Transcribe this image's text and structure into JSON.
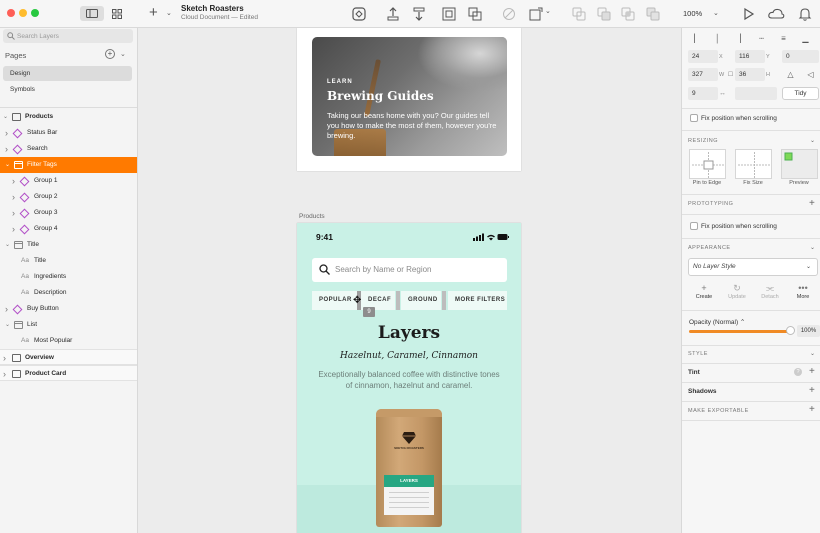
{
  "toolbar": {
    "doc_title": "Sketch Roasters",
    "doc_subtitle": "Cloud Document — Edited",
    "zoom": "100%"
  },
  "sidebar": {
    "search_placeholder": "Search Layers",
    "pages_label": "Pages",
    "pages": [
      {
        "label": "Design",
        "active": true
      },
      {
        "label": "Symbols",
        "active": false
      }
    ],
    "layers": [
      {
        "label": "Products",
        "type": "artboard",
        "level": 0,
        "expanded": true,
        "bold": true
      },
      {
        "label": "Status Bar",
        "type": "symbol",
        "level": 1,
        "expanded": false
      },
      {
        "label": "Search",
        "type": "symbol",
        "level": 1,
        "expanded": false
      },
      {
        "label": "Filter Tags",
        "type": "folder",
        "level": 1,
        "expanded": true,
        "selected": true
      },
      {
        "label": "Group 1",
        "type": "symbol",
        "level": 2,
        "expanded": false
      },
      {
        "label": "Group 2",
        "type": "symbol",
        "level": 2,
        "expanded": false
      },
      {
        "label": "Group 3",
        "type": "symbol",
        "level": 2,
        "expanded": false
      },
      {
        "label": "Group 4",
        "type": "symbol",
        "level": 2,
        "expanded": false
      },
      {
        "label": "Title",
        "type": "folder",
        "level": 1,
        "expanded": true
      },
      {
        "label": "Title",
        "type": "text",
        "level": 2
      },
      {
        "label": "Ingredients",
        "type": "text",
        "level": 2
      },
      {
        "label": "Description",
        "type": "text",
        "level": 2
      },
      {
        "label": "Buy Button",
        "type": "symbol",
        "level": 1,
        "expanded": false
      },
      {
        "label": "List",
        "type": "folder",
        "level": 1,
        "expanded": true
      },
      {
        "label": "Most Popular",
        "type": "text",
        "level": 2
      },
      {
        "label": "Overview",
        "type": "artboard",
        "level": 0,
        "expanded": false,
        "bold": true,
        "band": true
      },
      {
        "label": "Product Card",
        "type": "artboard",
        "level": 0,
        "expanded": false,
        "bold": true,
        "band": true
      }
    ]
  },
  "canvas": {
    "guide_card": {
      "eyebrow": "LEARN",
      "title": "Brewing Guides",
      "body": "Taking our beans home with you? Our guides tell you how to make the most of them, however you're brewing."
    },
    "artboard_label": "Products",
    "phone": {
      "time": "9:41",
      "search_placeholder": "Search by Name or Region",
      "filters": [
        "POPULAR",
        "DECAF",
        "GROUND",
        "MORE FILTERS"
      ],
      "spacing_badge": "9",
      "title": "Layers",
      "subtitle": "Hazelnut, Caramel, Cinnamon",
      "description": "Exceptionally balanced coffee with distinctive tones of cinnamon, hazelnut and caramel.",
      "bag_brand": "SKETCH ROASTERS",
      "bag_label": "LAYERS"
    }
  },
  "inspector": {
    "x": "24",
    "x_unit": "X",
    "y": "116",
    "y_unit": "Y",
    "rotation": "0",
    "w": "327",
    "w_unit": "W",
    "h": "36",
    "h_unit": "H",
    "spacing": "9",
    "tidy_label": "Tidy",
    "fix_position_1": "Fix position when scrolling",
    "resizing_head": "RESIZING",
    "resizing_options": [
      "Pin to Edge",
      "Fix Size",
      "Preview"
    ],
    "prototyping_head": "PROTOTYPING",
    "fix_position_2": "Fix position when scrolling",
    "appearance_head": "APPEARANCE",
    "layer_style": "No Layer Style",
    "actions": [
      {
        "label": "Create",
        "glyph": "+"
      },
      {
        "label": "Update",
        "glyph": "↻"
      },
      {
        "label": "Detach",
        "glyph": "⫘"
      },
      {
        "label": "More",
        "glyph": "•••"
      }
    ],
    "opacity_label": "Opacity (Normal) ⌃",
    "opacity_value": "100%",
    "opacity_fraction": 1.0,
    "style_head": "STYLE",
    "tint_label": "Tint",
    "shadows_label": "Shadows",
    "exportable_head": "MAKE EXPORTABLE"
  }
}
